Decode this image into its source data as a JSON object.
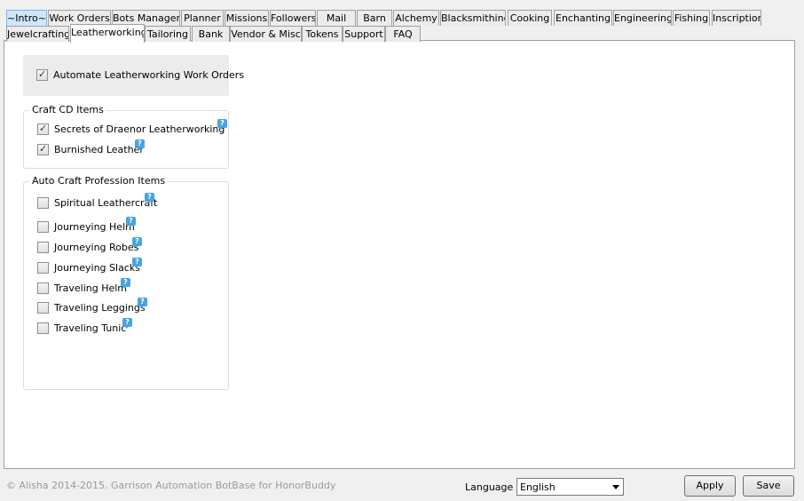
{
  "tabs_row1": [
    {
      "label": "~Intro~",
      "highlight": true
    },
    {
      "label": "Work Orders"
    },
    {
      "label": "Bots Manager"
    },
    {
      "label": "Planner"
    },
    {
      "label": "Missions"
    },
    {
      "label": "Followers"
    },
    {
      "label": "Mail"
    },
    {
      "label": "Barn"
    },
    {
      "label": "Alchemy"
    },
    {
      "label": "Blacksmithing"
    },
    {
      "label": "Cooking"
    },
    {
      "label": "Enchanting"
    },
    {
      "label": "Engineering"
    },
    {
      "label": "Fishing"
    },
    {
      "label": "Inscription"
    }
  ],
  "tabs_row2": [
    {
      "label": "Jewelcrafting"
    },
    {
      "label": "Leatherworking",
      "active": true
    },
    {
      "label": "Tailoring"
    },
    {
      "label": "Bank"
    },
    {
      "label": "Vendor & Misc"
    },
    {
      "label": "Tokens"
    },
    {
      "label": "Support"
    },
    {
      "label": "FAQ"
    }
  ],
  "automate": {
    "label": "Automate Leatherworking Work Orders",
    "checked": true
  },
  "craft_cd": {
    "title": "Craft CD Items",
    "items": [
      {
        "label": "Secrets of Draenor Leatherworking",
        "checked": true,
        "help_icon": "help-bubble-icon"
      },
      {
        "label": "Burnished Leather",
        "checked": true,
        "help_icon": "help-bubble-icon"
      }
    ]
  },
  "auto_craft": {
    "title": "Auto Craft Profession Items",
    "items": [
      {
        "label": "Spiritual Leathercraft",
        "checked": false
      },
      {
        "label": "Journeying Helm",
        "checked": false
      },
      {
        "label": "Journeying Robes",
        "checked": false
      },
      {
        "label": "Journeying Slacks",
        "checked": false
      },
      {
        "label": "Traveling Helm",
        "checked": false
      },
      {
        "label": "Traveling Leggings",
        "checked": false
      },
      {
        "label": "Traveling Tunic",
        "checked": false
      }
    ]
  },
  "footer": {
    "copyright": "© Alisha 2014-2015. Garrison Automation BotBase for HonorBuddy",
    "language_label": "Language",
    "language_value": "English",
    "apply_label": "Apply",
    "save_label": "Save"
  },
  "colors": {
    "help_icon": "#47a4e0",
    "tab_highlight": "#cfe6fb",
    "group_border": "#d5dfe5"
  }
}
